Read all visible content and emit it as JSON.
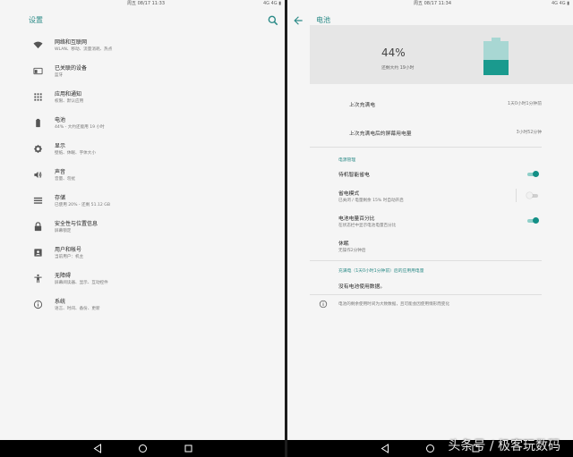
{
  "left": {
    "status_time": "周五 08/17 11:33",
    "status_icons": "4G 4G ▮",
    "title": "设置",
    "items": [
      {
        "icon": "wifi-icon",
        "title": "网络和互联网",
        "subtitle": "WLAN、移动、流量消耗、热点"
      },
      {
        "icon": "devices-icon",
        "title": "已关联的设备",
        "subtitle": "蓝牙"
      },
      {
        "icon": "apps-icon",
        "title": "应用和通知",
        "subtitle": "权限、默认应用"
      },
      {
        "icon": "battery-icon",
        "title": "电池",
        "subtitle": "44% - 大约还能用 19 小时"
      },
      {
        "icon": "brightness-icon",
        "title": "显示",
        "subtitle": "壁纸、休眠、字体大小"
      },
      {
        "icon": "volume-icon",
        "title": "声音",
        "subtitle": "音量、勿扰"
      },
      {
        "icon": "storage-icon",
        "title": "存储",
        "subtitle": "已使用 20% - 还剩 51.12 GB"
      },
      {
        "icon": "lock-icon",
        "title": "安全性与位置信息",
        "subtitle": "屏幕锁定"
      },
      {
        "icon": "account-icon",
        "title": "用户和帐号",
        "subtitle": "当前用户：机主"
      },
      {
        "icon": "accessibility-icon",
        "title": "无障碍",
        "subtitle": "屏幕阅读器、显示、互动控件"
      },
      {
        "icon": "info-icon",
        "title": "系统",
        "subtitle": "语言、时间、备份、更新"
      }
    ]
  },
  "right": {
    "status_time": "周五 08/17 11:34",
    "status_icons": "4G 4G ▮",
    "title": "电池",
    "battery": {
      "percent_text": "44%",
      "level": 0.44,
      "remaining": "还剩大约 19小时"
    },
    "last_full_charge": {
      "label": "上次充满电",
      "value": "1天0小时1分钟前"
    },
    "screen_usage": {
      "label": "上次充满电后的屏幕用电量",
      "value": "3小时52分钟"
    },
    "power_management_header": "电源管理",
    "smart_saver": {
      "title": "待机智能省电",
      "on": true
    },
    "battery_saver": {
      "title": "省电模式",
      "subtitle": "已关闭 / 电量剩余 15% 时自动开启",
      "on": false
    },
    "battery_percentage": {
      "title": "电池电量百分比",
      "subtitle": "在状态栏中显示电池电量百分比",
      "on": true
    },
    "sleep": {
      "title": "休眠",
      "subtitle": "无操作2分钟后"
    },
    "app_usage_header": "充满电（1天0小时1分钟前）后的应用用电量",
    "no_usage": "没有电池使用数据。",
    "note": "电池的剩余使用时间为大致数据，且可能会因使用情形而变化"
  },
  "watermark": "头条号 / 极客玩数码",
  "colors": {
    "accent": "#2a8a87",
    "toggle_on": "#138f86",
    "battery_fill": "#1a9a8e"
  }
}
